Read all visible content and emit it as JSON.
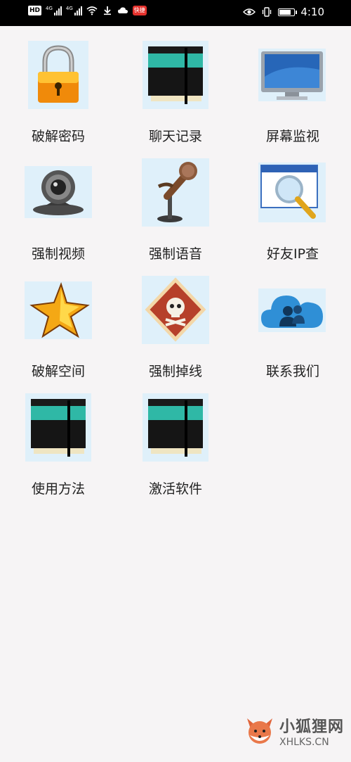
{
  "status_bar": {
    "hd": "HD",
    "signal_label_1": "4G",
    "signal_label_2": "4G",
    "app_badge": "快捷",
    "battery_level": 0.8,
    "time": "4:10"
  },
  "menu": {
    "items": [
      {
        "label": "破解密码",
        "icon": "padlock-icon"
      },
      {
        "label": "聊天记录",
        "icon": "notebook-icon"
      },
      {
        "label": "屏幕监视",
        "icon": "monitor-icon"
      },
      {
        "label": "强制视频",
        "icon": "webcam-icon"
      },
      {
        "label": "强制语音",
        "icon": "microphone-icon"
      },
      {
        "label": "好友IP查",
        "icon": "magnifier-window-icon"
      },
      {
        "label": "破解空间",
        "icon": "star-icon"
      },
      {
        "label": "强制掉线",
        "icon": "skull-warning-icon"
      },
      {
        "label": "联系我们",
        "icon": "cloud-users-icon"
      },
      {
        "label": "使用方法",
        "icon": "notebook-icon"
      },
      {
        "label": "激活软件",
        "icon": "notebook-icon"
      }
    ]
  },
  "watermark": {
    "cn": "小狐狸网",
    "en": "XHLKS.CN"
  },
  "colors": {
    "background": "#f6f4f5",
    "icon_bg": "#dff0fa",
    "status_bar": "#000000"
  }
}
